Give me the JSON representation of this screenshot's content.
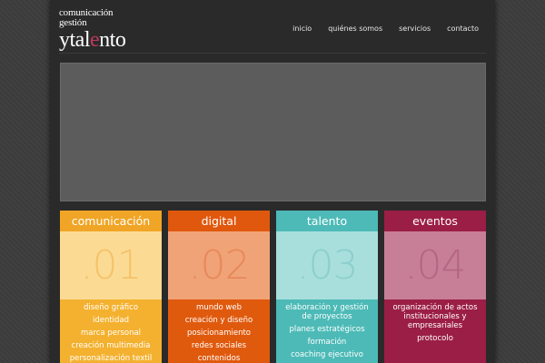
{
  "logo": {
    "line1": "comunicación",
    "line2": "gestión",
    "line3_pre": "ytal",
    "line3_accent": "e",
    "line3_post": "nto",
    "accent_color": "#c0395a"
  },
  "nav": {
    "items": [
      "inicio",
      "quiénes somos",
      "servicios",
      "contacto"
    ]
  },
  "columns": [
    {
      "title": "comunicación",
      "number": ".01",
      "colors": {
        "header": "#f0a526",
        "body": "#fbdb94",
        "num": "#f5c26a",
        "list": "#f4b12f"
      },
      "items": [
        "diseño gráfico",
        "identidad",
        "marca personal",
        "creación multimedia",
        "personalización textil"
      ]
    },
    {
      "title": "digital",
      "number": ".02",
      "colors": {
        "header": "#e0580d",
        "body": "#f1a378",
        "num": "#e7895a",
        "list": "#e05a0e"
      },
      "items": [
        "mundo web",
        "creación y diseño",
        "posicionamiento",
        "redes sociales",
        "contenidos"
      ]
    },
    {
      "title": "talento",
      "number": ".03",
      "colors": {
        "header": "#4dbab7",
        "body": "#a8dfdd",
        "num": "#8ccfcd",
        "list": "#4dbab7"
      },
      "items": [
        "elaboración y gestión de proyectos",
        "planes estratégicos",
        "formación",
        "coaching ejecutivo"
      ]
    },
    {
      "title": "eventos",
      "number": ".04",
      "colors": {
        "header": "#9b1e46",
        "body": "#c77f98",
        "num": "#b56682",
        "list": "#9b1e46"
      },
      "items": [
        "organización de actos institucionales y empresariales",
        "protocolo"
      ]
    }
  ]
}
